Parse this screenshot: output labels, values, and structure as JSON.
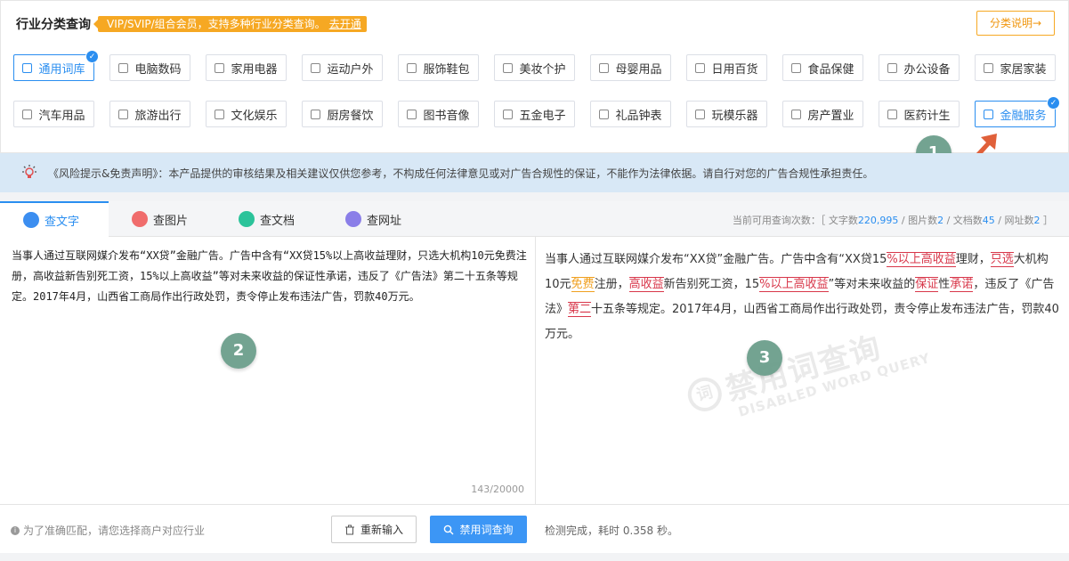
{
  "header": {
    "title": "行业分类查询",
    "vip_text": "VIP/SVIP/组合会员，支持多种行业分类查询。",
    "vip_link": "去开通",
    "explain_button": "分类说明→"
  },
  "categories": [
    {
      "label": "通用词库",
      "icon": "book-icon",
      "active": true
    },
    {
      "label": "电脑数码",
      "icon": "monitor-icon"
    },
    {
      "label": "家用电器",
      "icon": "appliance-icon"
    },
    {
      "label": "运动户外",
      "icon": "sport-icon"
    },
    {
      "label": "服饰鞋包",
      "icon": "bag-icon"
    },
    {
      "label": "美妆个护",
      "icon": "cosmetics-icon"
    },
    {
      "label": "母婴用品",
      "icon": "baby-bottle-icon"
    },
    {
      "label": "日用百货",
      "icon": "store-icon"
    },
    {
      "label": "食品保健",
      "icon": "food-icon"
    },
    {
      "label": "办公设备",
      "icon": "office-icon"
    },
    {
      "label": "家居家装",
      "icon": "home-icon"
    },
    {
      "label": "汽车用品",
      "icon": "car-icon"
    },
    {
      "label": "旅游出行",
      "icon": "plane-icon"
    },
    {
      "label": "文化娱乐",
      "icon": "film-icon"
    },
    {
      "label": "厨房餐饮",
      "icon": "kitchen-icon"
    },
    {
      "label": "图书音像",
      "icon": "book-media-icon"
    },
    {
      "label": "五金电子",
      "icon": "tools-icon"
    },
    {
      "label": "礼品钟表",
      "icon": "clock-icon"
    },
    {
      "label": "玩模乐器",
      "icon": "toy-icon"
    },
    {
      "label": "房产置业",
      "icon": "building-icon"
    },
    {
      "label": "医药计生",
      "icon": "medical-icon"
    },
    {
      "label": "金融服务",
      "icon": "coin-icon",
      "active": true
    }
  ],
  "markers": {
    "m1": "1",
    "m2": "2",
    "m3": "3"
  },
  "notice": {
    "text": "《风险提示&免责声明》：本产品提供的审核结果及相关建议仅供您参考，不构成任何法律意见或对广告合规性的保证，不能作为法律依据。请自行对您的广告合规性承担责任。"
  },
  "tabs": [
    {
      "label": "查文字",
      "icon": "text-icon",
      "color": "#3c8ef0"
    },
    {
      "label": "查图片",
      "icon": "image-icon",
      "color": "#f06c6c"
    },
    {
      "label": "查文档",
      "icon": "doc-icon",
      "color": "#2bc39a"
    },
    {
      "label": "查网址",
      "icon": "globe-icon",
      "color": "#8a7ee8"
    }
  ],
  "quota": {
    "prefix": "当前可用查询次数：［ 文字数",
    "text_count": "220,995",
    "img_label": " / 图片数",
    "img_count": "2",
    "doc_label": " / 文档数",
    "doc_count": "45",
    "url_label": " / 网址数",
    "url_count": "2",
    "suffix": " ］"
  },
  "editor": {
    "text": "当事人通过互联网媒介发布“XX贷”金融广告。广告中含有“XX贷15%以上高收益理财，只选大机构10元免费注册，高收益新告别死工资，15%以上高收益”等对未来收益的保证性承诺，违反了《广告法》第二十五条等规定。2017年4月，山西省工商局作出行政处罚，责令停止发布违法广告，罚款40万元。",
    "counter": "143/20000"
  },
  "result": {
    "segments": [
      {
        "t": "当事人通过互联网媒介发布“XX贷”金融广告。广告中含有“XX贷15"
      },
      {
        "t": "%以上",
        "h": "red"
      },
      {
        "t": "高收益",
        "h": "red"
      },
      {
        "t": "理财，"
      },
      {
        "t": "只选",
        "h": "red"
      },
      {
        "t": "大机构10元"
      },
      {
        "t": "免费",
        "h": "yellow"
      },
      {
        "t": "注册，"
      },
      {
        "t": "高收益",
        "h": "red"
      },
      {
        "t": "新告别死工资，15"
      },
      {
        "t": "%以上",
        "h": "red"
      },
      {
        "t": "高收益",
        "h": "red"
      },
      {
        "t": "”等对未来收益的"
      },
      {
        "t": "保证",
        "h": "red"
      },
      {
        "t": "性"
      },
      {
        "t": "承诺",
        "h": "red"
      },
      {
        "t": "，违反了《广告法》"
      },
      {
        "t": "第二",
        "h": "red"
      },
      {
        "t": "十五条等规定。2017年4月，山西省工商局作出行政处罚，责令停止发布违法广告，罚款40万元。"
      }
    ],
    "watermark_main": "禁用词查询",
    "watermark_sub": "DISABLED WORD QUERY",
    "watermark_seal": "词"
  },
  "footer": {
    "tip": "为了准确匹配，请您选择商户对应行业",
    "reset_button": "重新输入",
    "query_button": "禁用词查询",
    "status": "检测完成，耗时 0.358 秒。"
  },
  "colors": {
    "accent": "#2a8ef0",
    "vip": "#f6a823",
    "highlight_red": "#d8374a",
    "highlight_yellow": "#f0a020",
    "marker": "#6c9f8c",
    "arrow": "#e0603a"
  }
}
